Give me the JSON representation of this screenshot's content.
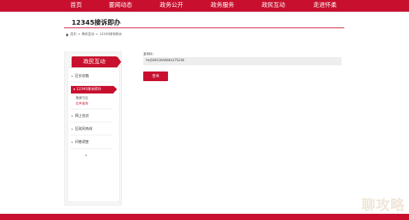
{
  "nav": {
    "items": [
      "首页",
      "要闻动态",
      "政务公开",
      "政务服务",
      "政民互动",
      "走进怀柔"
    ]
  },
  "page_title": "12345接诉即办",
  "breadcrumb": {
    "home": "首页",
    "sep": ">",
    "level1": "政民互动",
    "level2": "12345接诉即办"
  },
  "sidebar": {
    "header": "政民互动",
    "items": [
      {
        "label": "区长信箱"
      },
      {
        "label": "12345接诉即办"
      },
      {
        "label": "网上信访"
      },
      {
        "label": "区政风热线"
      },
      {
        "label": "问卷调查"
      }
    ],
    "subitems": [
      "我要写信",
      "信件查询"
    ]
  },
  "form": {
    "label": "查询码：",
    "value": "hhj50013646681275236",
    "button": "查询"
  },
  "watermark": "聊攻略",
  "colors": {
    "brand": "#c8102e"
  }
}
